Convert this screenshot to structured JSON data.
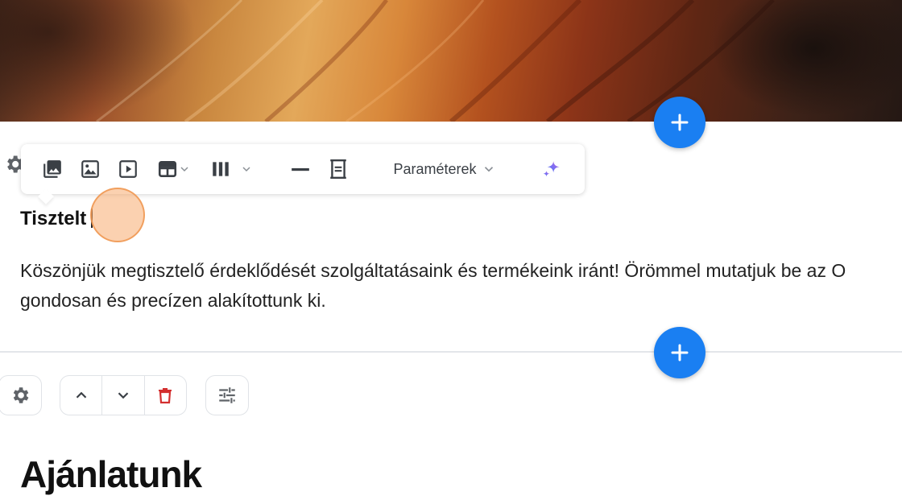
{
  "editor": {
    "toolbar": {
      "parameters_label": "Paraméterek",
      "icons": [
        "image-gallery-icon",
        "image-icon",
        "video-icon",
        "table-icon",
        "columns-icon",
        "horizontal-rule-icon",
        "spacer-icon",
        "ai-sparkle-icon"
      ]
    },
    "heading_text": "Tisztelt",
    "paragraph": {
      "line1": "Köszönjük megtisztelő érdeklődését szolgáltatásaink és termékeink iránt! Örömmel mutatjuk be az O",
      "line2": "gondosan és precízen alakítottunk ki."
    },
    "section_title": "Ajánlatunk"
  },
  "colors": {
    "accent": "#1a7ff2",
    "delete": "#d32f2f",
    "icon": "#3a3f45",
    "cursor_highlight": "#f8ac70"
  }
}
